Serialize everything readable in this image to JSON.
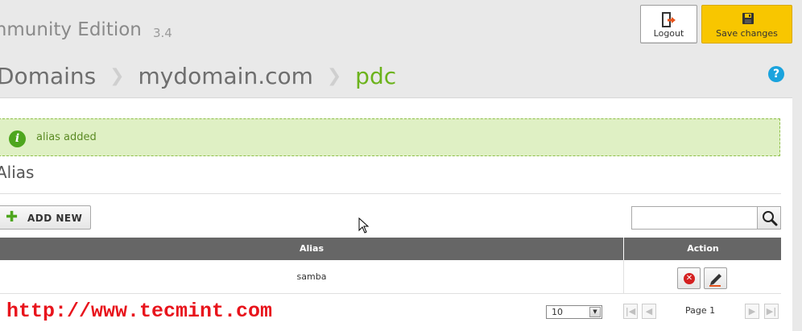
{
  "header": {
    "title": "mmunity Edition",
    "version": "3.4",
    "logout_label": "Logout",
    "save_label": "Save changes"
  },
  "breadcrumb": {
    "items": [
      "Domains",
      "mydomain.com"
    ],
    "current": "pdc",
    "separator": "❯"
  },
  "help_label": "?",
  "alert": {
    "icon": "info-icon",
    "text": "alias added"
  },
  "section": {
    "title": "Alias",
    "add_button": "ADD NEW"
  },
  "search": {
    "value": "",
    "placeholder": ""
  },
  "table": {
    "columns": [
      "Alias",
      "Action"
    ],
    "rows": [
      {
        "alias": "samba"
      }
    ]
  },
  "pagination": {
    "page_size": "10",
    "page_label": "Page 1"
  },
  "watermark": "http://www.tecmint.com",
  "colors": {
    "accent_green": "#6cb31c",
    "save_button": "#f8c600",
    "help_blue": "#1aa3dd",
    "table_header": "#666666",
    "watermark_red": "#e8141c"
  }
}
